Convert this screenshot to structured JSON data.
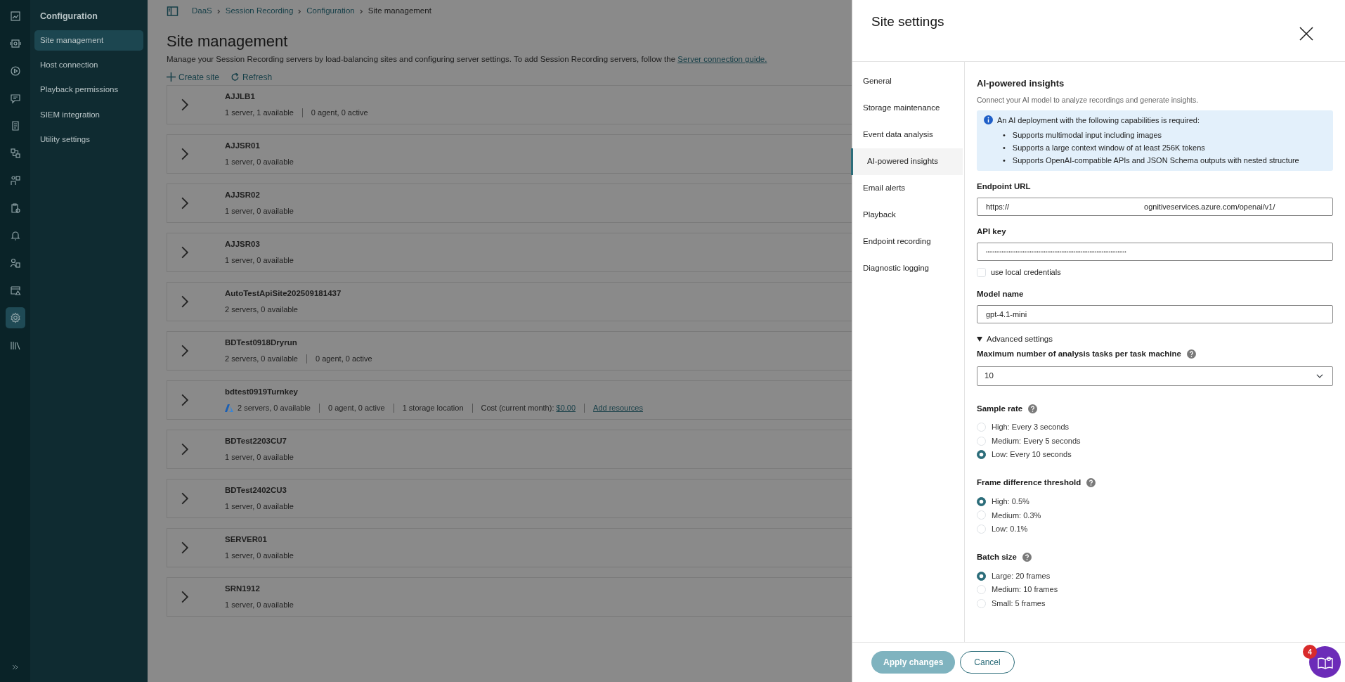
{
  "rail": [
    {
      "kind": "dashboard",
      "selected": false
    },
    {
      "kind": "monitor",
      "selected": false
    },
    {
      "kind": "play",
      "selected": false
    },
    {
      "kind": "chat",
      "selected": false
    },
    {
      "kind": "document",
      "selected": false
    },
    {
      "kind": "flow",
      "selected": false
    },
    {
      "kind": "person-chart",
      "selected": false
    },
    {
      "kind": "clipboard",
      "selected": false
    },
    {
      "kind": "bell",
      "selected": false
    },
    {
      "kind": "person-list",
      "selected": false
    },
    {
      "kind": "warning-window",
      "selected": false
    },
    {
      "kind": "settings",
      "selected": true
    },
    {
      "kind": "library",
      "selected": false
    }
  ],
  "nav": {
    "title": "Configuration",
    "items": [
      {
        "label": "Site management",
        "selected": true
      },
      {
        "label": "Host connection",
        "selected": false
      },
      {
        "label": "Playback permissions",
        "selected": false
      },
      {
        "label": "SIEM integration",
        "selected": false
      },
      {
        "label": "Utility settings",
        "selected": false
      }
    ]
  },
  "breadcrumb": [
    {
      "label": "DaaS",
      "link": true
    },
    {
      "label": "Session Recording",
      "link": true
    },
    {
      "label": "Configuration",
      "link": true
    },
    {
      "label": "Site management",
      "link": false
    }
  ],
  "page": {
    "title": "Site management",
    "description": "Manage your Session Recording servers by load-balancing sites and configuring server settings. To add Session Recording servers, follow the",
    "description_link": "Server connection guide.",
    "actions": [
      {
        "kind": "add",
        "label": "Create site"
      },
      {
        "kind": "refresh",
        "label": "Refresh"
      }
    ]
  },
  "sites": [
    {
      "name": "AJJLB1",
      "cloud": false,
      "meta": [
        {
          "text": "1 server, 1 available"
        },
        {
          "text": "0 agent, 0 active"
        }
      ]
    },
    {
      "name": "AJJSR01",
      "cloud": false,
      "meta": [
        {
          "text": "1 server, 0 available"
        }
      ]
    },
    {
      "name": "AJJSR02",
      "cloud": false,
      "meta": [
        {
          "text": "1 server, 0 available"
        }
      ]
    },
    {
      "name": "AJJSR03",
      "cloud": false,
      "meta": [
        {
          "text": "1 server, 0 available"
        }
      ]
    },
    {
      "name": "AutoTestApiSite202509181437",
      "cloud": false,
      "meta": [
        {
          "text": "2 servers, 0 available"
        }
      ]
    },
    {
      "name": "BDTest0918Dryrun",
      "cloud": false,
      "meta": [
        {
          "text": "2 servers, 0 available"
        },
        {
          "text": "0 agent, 0 active"
        }
      ]
    },
    {
      "name": "bdtest0919Turnkey",
      "cloud": true,
      "meta": [
        {
          "text": "2 servers, 0 available"
        },
        {
          "text": "0 agent, 0 active"
        },
        {
          "text": "1 storage location"
        },
        {
          "text": "Cost (current month):",
          "link": "$0.00"
        },
        {
          "link": "Add resources"
        }
      ]
    },
    {
      "name": "BDTest2203CU7",
      "cloud": false,
      "meta": [
        {
          "text": "1 server, 0 available"
        }
      ]
    },
    {
      "name": "BDTest2402CU3",
      "cloud": false,
      "meta": [
        {
          "text": "1 server, 0 available"
        }
      ]
    },
    {
      "name": "SERVER01",
      "cloud": false,
      "meta": [
        {
          "text": "1 server, 0 available"
        }
      ]
    },
    {
      "name": "SRN1912",
      "cloud": false,
      "meta": [
        {
          "text": "1 server, 0 available"
        }
      ]
    }
  ],
  "panel": {
    "title": "Site settings",
    "tabs": [
      {
        "label": "General",
        "selected": false
      },
      {
        "label": "Storage maintenance",
        "selected": false
      },
      {
        "label": "Event data analysis",
        "selected": false
      },
      {
        "label": "AI-powered insights",
        "selected": true
      },
      {
        "label": "Email alerts",
        "selected": false
      },
      {
        "label": "Playback",
        "selected": false
      },
      {
        "label": "Endpoint recording",
        "selected": false
      },
      {
        "label": "Diagnostic logging",
        "selected": false
      }
    ],
    "heading": "AI-powered insights",
    "description": "Connect your AI model to analyze recordings and generate insights.",
    "info": {
      "text": "An AI deployment with the following capabilities is required:",
      "items": [
        {
          "bullet": "•",
          "text": "Supports multimodal input including images"
        },
        {
          "bullet": "•",
          "text": "Supports a large context window of at least 256K tokens"
        },
        {
          "bullet": "•",
          "text": "Supports OpenAI-compatible APIs and JSON Schema outputs with nested structure"
        }
      ]
    },
    "endpoint": {
      "label": "Endpoint URL",
      "value_start": "https://",
      "value_end": "ognitiveservices.azure.com/openai/v1/"
    },
    "api_key": {
      "label": "API key",
      "value": "••••••••••••••••••••••••••••••••••••••••••••••••••••••••••••••••••••••••••••••••"
    },
    "local_credentials": {
      "label": "use local credentials",
      "checked": false
    },
    "model": {
      "label": "Model name",
      "value": "gpt-4.1-mini"
    },
    "advanced": {
      "label": "Advanced settings",
      "expanded": true
    },
    "max_tasks": {
      "label": "Maximum number of analysis tasks per task machine",
      "value": "10"
    },
    "groups": [
      {
        "label": "Sample rate",
        "options": [
          {
            "label": "High: Every 3 seconds",
            "selected": false
          },
          {
            "label": "Medium: Every 5 seconds",
            "selected": false
          },
          {
            "label": "Low: Every 10 seconds",
            "selected": true
          }
        ]
      },
      {
        "label": "Frame difference threshold",
        "options": [
          {
            "label": "High: 0.5%",
            "selected": true
          },
          {
            "label": "Medium: 0.3%",
            "selected": false
          },
          {
            "label": "Low: 0.1%",
            "selected": false
          }
        ]
      },
      {
        "label": "Batch size",
        "options": [
          {
            "label": "Large: 20 frames",
            "selected": true
          },
          {
            "label": "Medium: 10 frames",
            "selected": false
          },
          {
            "label": "Small: 5 frames",
            "selected": false
          }
        ]
      }
    ],
    "buttons": [
      {
        "kind": "primary",
        "label": "Apply changes",
        "disabled": true
      },
      {
        "kind": "secondary",
        "label": "Cancel",
        "disabled": false
      }
    ],
    "help_badge": "4"
  }
}
